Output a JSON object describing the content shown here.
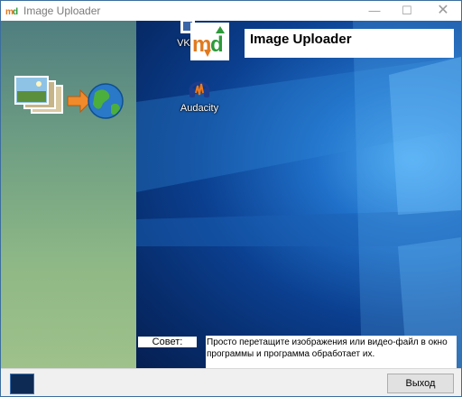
{
  "window": {
    "title": "Image Uploader",
    "controls": {
      "minimize": "—",
      "maximize": "☐",
      "close": "✕"
    }
  },
  "header": {
    "app_title": "Image Uploader"
  },
  "desktop_icons": [
    {
      "label": "VKM",
      "icon": "app-icon"
    },
    {
      "label": "Audacity",
      "icon": "audacity-icon"
    }
  ],
  "hint": {
    "label": "Совет:",
    "text": "Просто перетащите изображения или видео-файл в окно программы и программа обработает их."
  },
  "footer": {
    "exit_label": "Выход"
  },
  "colors": {
    "side_panel_top": "#4f7e80",
    "side_panel_bottom": "#9fc18a",
    "desktop": "#0b3f8f"
  }
}
